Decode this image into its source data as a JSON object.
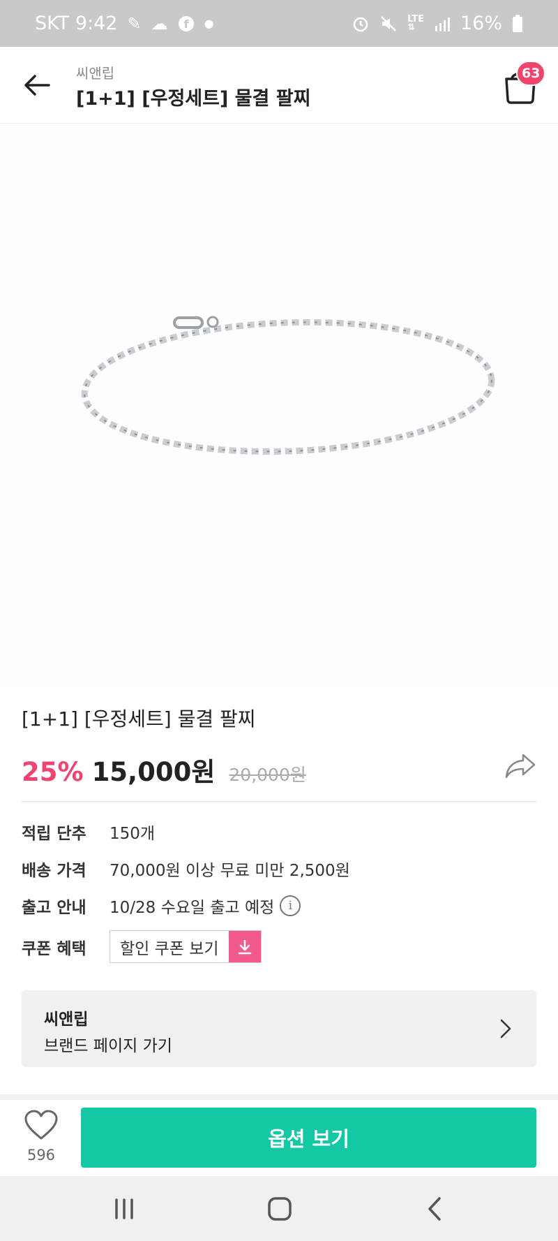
{
  "status_bar": {
    "carrier_time": "SKT 9:42",
    "battery": "16%",
    "left_icons": [
      "feather-icon",
      "cloud-icon",
      "facebook-icon",
      "dot-icon"
    ],
    "right_icons": [
      "alarm-icon",
      "mute-icon",
      "lte-icon",
      "signal-icon",
      "battery-icon"
    ]
  },
  "header": {
    "brand": "씨앤립",
    "title": "[1+1] [우정세트] 물결 팔찌",
    "cart_count": "63"
  },
  "product": {
    "name": "[1+1] [우정세트] 물결 팔찌",
    "discount": "25%",
    "price": "15,000원",
    "original_price": "20,000원"
  },
  "info": {
    "points_label": "적립 단추",
    "points_value": "150개",
    "shipping_label": "배송 가격",
    "shipping_value": "70,000원 이상 무료 미만 2,500원",
    "release_label": "출고 안내",
    "release_value": "10/28 수요일 출고 예정",
    "coupon_label": "쿠폰 혜택",
    "coupon_button": "할인 쿠폰 보기"
  },
  "brand_card": {
    "name": "씨앤립",
    "link": "브랜드 페이지 가기"
  },
  "bottom_bar": {
    "like_count": "596",
    "option_button": "옵션 보기"
  },
  "colors": {
    "accent_pink": "#ee4470",
    "coupon_pink": "#f25a8e",
    "primary_green": "#15c8a5",
    "badge": "#f0456b"
  }
}
